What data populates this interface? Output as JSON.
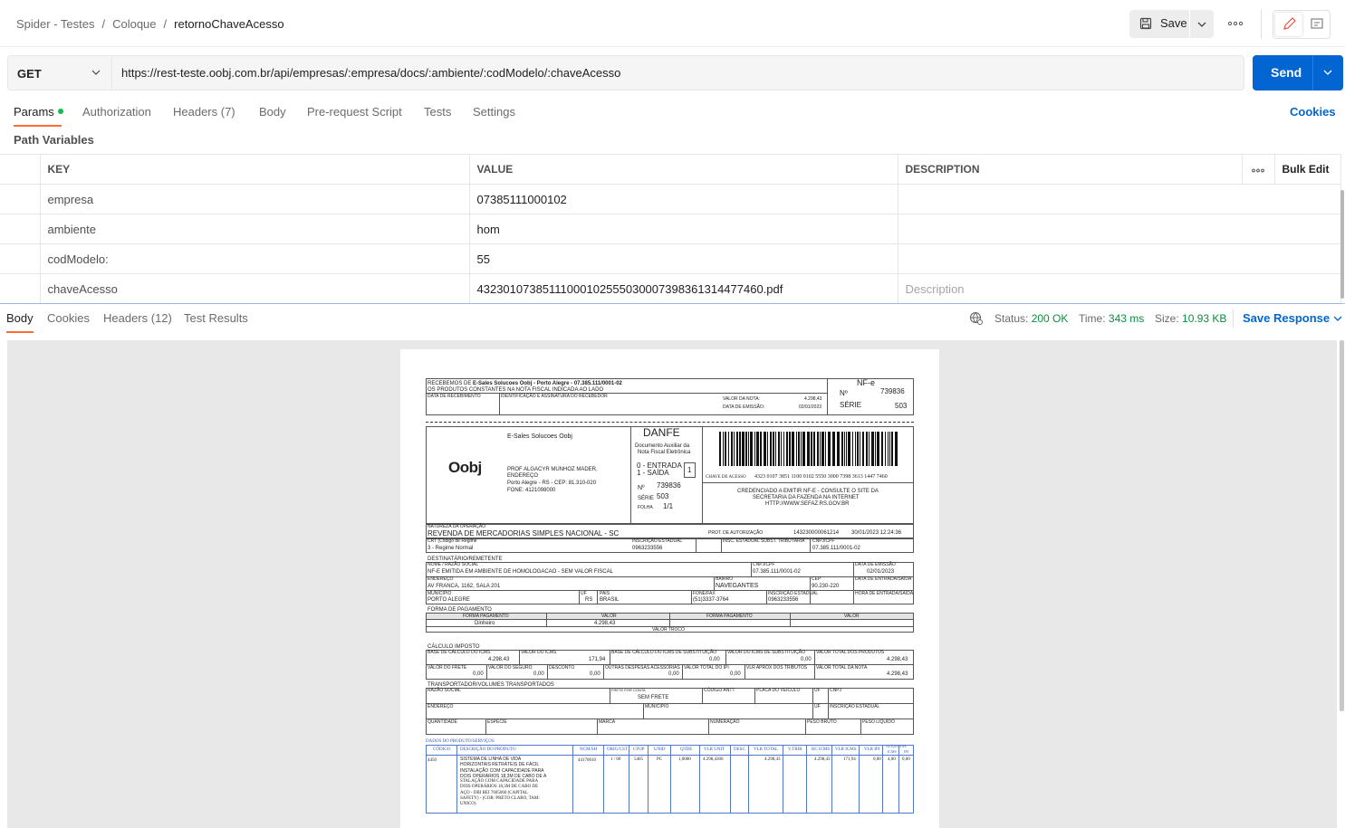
{
  "breadcrumb": {
    "part1": "Spider - Testes",
    "sep": "/",
    "part2": "Coloque",
    "current": "retornoChaveAcesso"
  },
  "toolbar": {
    "save_label": "Save"
  },
  "request": {
    "method": "GET",
    "url": "https://rest-teste.oobj.com.br/api/empresas/:empresa/docs/:ambiente/:codModelo/:chaveAcesso",
    "send_label": "Send"
  },
  "req_tabs": [
    "Params",
    "Authorization",
    "Headers (7)",
    "Body",
    "Pre-request Script",
    "Tests",
    "Settings"
  ],
  "cookies_link": "Cookies",
  "path_variables": {
    "title": "Path Variables",
    "headers": {
      "key": "KEY",
      "value": "VALUE",
      "description": "DESCRIPTION",
      "bulk": "Bulk Edit"
    },
    "rows": [
      {
        "key": "empresa",
        "value": "07385111000102",
        "description": ""
      },
      {
        "key": "ambiente",
        "value": "hom",
        "description": ""
      },
      {
        "key": "codModelo:",
        "value": "55",
        "description": ""
      },
      {
        "key": "chaveAcesso",
        "value": "43230107385111000102555030007398361314477460.pdf",
        "description": "Description"
      }
    ]
  },
  "resp_tabs": [
    "Body",
    "Cookies",
    "Headers (12)",
    "Test Results"
  ],
  "response": {
    "status_label": "Status:",
    "status": "200 OK",
    "time_label": "Time:",
    "time": "343 ms",
    "size_label": "Size:",
    "size": "10.93 KB",
    "save_response": "Save Response"
  },
  "danfe": {
    "recebemos": "RECEBEMOS DE",
    "emitente_short": "E-Sales Solucoes Oobj - Porto Alegre - 07.385.111/0001-02",
    "produtos_text": "OS PRODUTOS CONSTANTES NA NOTA FISCAL INDICADA AO LADO",
    "data_receb": "DATA DE RECEBIMENTO",
    "ident_assin": "IDENTIFICAÇÃO E ASSINATURA DO RECEBEDOR",
    "valor_nota_label": "VALOR DA NOTA:",
    "valor_nota": "4.298,43",
    "data_emissao_label": "DATA DE EMISSÃO:",
    "data_emissao": "02/01/2023",
    "nfe": "NF-e",
    "numero_label": "Nº",
    "numero": "739836",
    "serie_label": "SÉRIE",
    "serie": "503",
    "emitente": "E-Sales Solucoes Oobj",
    "logo": "Oobj",
    "endereco1": "PROF ALGACYR MUNHOZ MADER,",
    "endereco2": "ENDEREÇO",
    "endereco3": "Porto Alegre - RS - CEP: 81.310-020",
    "fone": "FONE: 4121098000",
    "danfe_title": "DANFE",
    "danfe_sub1": "Documento Auxiliar da",
    "danfe_sub2": "Nota Fiscal Eletrônica",
    "entrada": "0 - ENTRADA",
    "saida": "1 - SAÍDA",
    "tipo": "1",
    "folha_label": "FOLHA",
    "folha": "1/1",
    "chave_label": "CHAVE DE ACESSO",
    "chave": "4323 0107 3851 1100 0102 5550 3000 7398 3613 1447 7460",
    "credenciado1": "CREDENCIADO A EMITIR NF-E - CONSULTE O SITE DA",
    "credenciado2": "SECRETARIA DA FAZENDA NA INTERNET",
    "credenciado3": "HTTP://WWW.SEFAZ.RS.GOV.BR",
    "natureza_label": "NATUREZA DA OPERAÇÃO",
    "natureza": "REVENDA DE MERCADORIAS SIMPLES NACIONAL - SC",
    "protocolo_label": "PROT. DE AUTORIZAÇÃO",
    "protocolo": "143230000061214",
    "protocolo_data": "30/01/2023 12:24:36",
    "crt_label": "CRT (Código de Regime",
    "crt": "3 - Regime Normal",
    "ie_label": "INSCRIÇÃO ESTADUAL",
    "ie": "0963233556",
    "ie_st_label": "INSC. ESTADUAL SUBST. TRIBUTÁRIA",
    "cnpj_label": "CNPJ/CPF",
    "cnpj": "07.385.111/0001-02",
    "dest_title": "DESTINATÁRIO/REMETENTE",
    "nome_label": "NOME / RAZÃO SOCIAL",
    "nome": "NF-E EMITIDA EM AMBIENTE DE HOMOLOGACAO - SEM VALOR FISCAL",
    "dest_cnpj": "07.385.111/0001-02",
    "dest_emissao_label": "DATA DE EMISSÃO",
    "dest_emissao": "02/01/2023",
    "end_label": "ENDEREÇO",
    "end": "AV FRANCA, 1162, SALA 201",
    "bairro_label": "BAIRRO",
    "bairro": "NAVEGANTES",
    "cep_label": "CEP",
    "cep": "90.230-220",
    "entrada_saida_label": "DATA DE ENTRADA/SAÍDA",
    "municipio_label": "MUNICÍPIO",
    "municipio": "PORTO ALEGRE",
    "uf_label": "UF",
    "uf": "RS",
    "pais_label": "PAÍS",
    "pais": "BRASIL",
    "fone_label": "FONE/FAX",
    "fone_dest": "(51)3337-3764",
    "ie_dest": "0963233556",
    "hora_label": "HORA DE ENTRADA/SAÍDA",
    "pag_title": "FORMA DE PAGAMENTO",
    "pag_h1": "FORMA PAGAMENTO",
    "pag_h2": "VALOR",
    "pag_h3": "FORMA PAGAMENTO",
    "pag_h4": "VALOR",
    "pag_forma": "Dinheiro",
    "pag_valor": "4.298,43",
    "valor_troco": "VALOR TROCO",
    "calc_title": "CÁLCULO IMPOSTO",
    "bc_icms": "BASE DE CÁLCULO DO ICMS",
    "bc_icms_v": "4.298,43",
    "v_icms": "VALOR DO ICMS",
    "v_icms_v": "171,94",
    "bc_st": "BASE DE CÁLCULO DO ICMS DE SUBSTITUIÇÃO",
    "bc_st_v": "0,00",
    "v_st": "VALOR DO ICMS DE SUBSTITUIÇÃO",
    "v_st_v": "0,00",
    "v_prod": "VALOR TOTAL DOS PRODUTOS",
    "v_prod_v": "4.298,43",
    "frete": "VALOR DO FRETE",
    "frete_v": "0,00",
    "seguro": "VALOR DO SEGURO",
    "seguro_v": "0,00",
    "desconto": "DESCONTO",
    "desconto_v": "0,00",
    "outras": "OUTRAS DESPESAS ACESSÓRIAS",
    "outras_v": "0,00",
    "ipi": "VALOR TOTAL DO IPI",
    "ipi_v": "0,00",
    "aprox": "VLR APROX DOS TRIBUTOS",
    "total_nota": "VALOR TOTAL DA NOTA",
    "total_nota_v": "4.298,43",
    "transp_title": "TRANSPORTADOR/VOLUMES TRANSPORTADOS",
    "razao": "RAZÃO SOCIAL",
    "frete_conta": "FRETE POR CONTA",
    "frete_conta_v": "SEM FRETE",
    "antt": "CÓDIGO ANTT",
    "placa": "PLACA DO VEÍCULO",
    "uf2": "UF",
    "cnpj2": "CNPJ",
    "municipio2": "MUNICÍPIO",
    "uf3": "UF",
    "ie2": "INSCRIÇÃO ESTADUAL",
    "quantidade": "QUANTIDADE",
    "especie": "ESPÉCIE",
    "marca": "MARCA",
    "numeracao": "NUMERAÇÃO",
    "peso_bruto": "PESO BRUTO",
    "peso_liquido": "PESO LÍQUIDO",
    "prod_title": "DADOS DO PRODUTO/SERVIÇOS",
    "prod_headers": [
      "CÓDIGO",
      "DESCRIÇÃO DO PRODUTO",
      "NCM/SH",
      "ORIG/CST",
      "CFOP",
      "UNID",
      "QTDE",
      "VLR UNIT",
      "DESC",
      "VLR TOTAL",
      "V.TRIB",
      "BC ICMS",
      "VLR ICMS",
      "VLR IPI",
      "ALÍQUOTAS"
    ],
    "aliq_sub": [
      "ICMS",
      "IPI"
    ],
    "prod_row": [
      "4450",
      "",
      "44170010",
      "1 / 00",
      "5405",
      "PC",
      "1,0000",
      "4.298,4300",
      "",
      "4.298,43",
      "",
      "4.298,43",
      "171,94",
      "0,00",
      "4,00",
      "0,00"
    ],
    "prod_desc": [
      "SISTEMA DE LINHA DE VIDA",
      "HORIZONTAIS RETRÁTEIS DE FÁCIL",
      "INSTALAÇÃO COM CAPACIDADE PARA",
      "DOIS OPERÁRIOS 18,3M DE CABO DE A",
      "STALAÇÃO COM CAPACIDADE PARA",
      "DOIS OPERÁRIOS 18,3M DE CABO DE",
      "AÇO - DBI REI 7605060 (CAPITAL",
      "SAFETY) - (COR: PRETO CLARO, TAM:",
      "UNICO)"
    ]
  }
}
